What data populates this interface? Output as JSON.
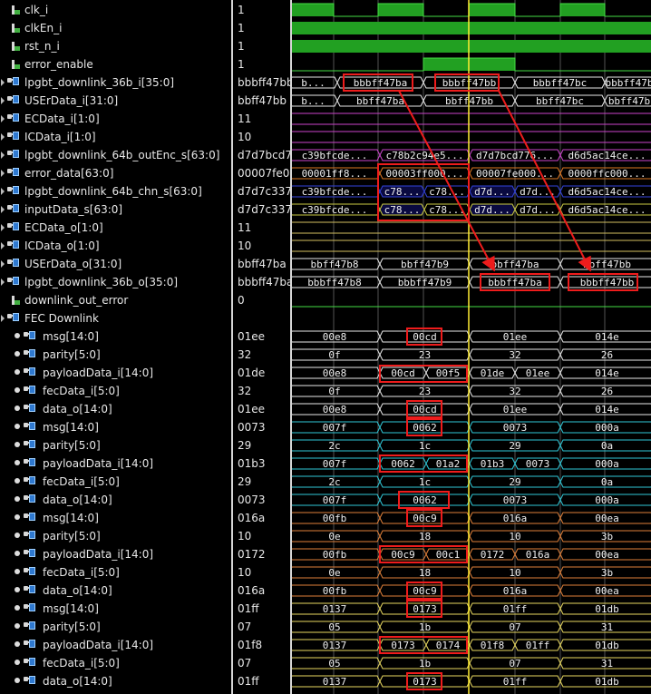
{
  "rows": [
    {
      "name": "clk_i",
      "value": "1",
      "kind": "bit",
      "wave": "clk"
    },
    {
      "name": "clkEn_i",
      "value": "1",
      "kind": "bit",
      "wave": "high"
    },
    {
      "name": "rst_n_i",
      "value": "1",
      "kind": "bit",
      "wave": "high"
    },
    {
      "name": "error_enable",
      "value": "1",
      "kind": "bit",
      "wave": "errEn"
    },
    {
      "name": "lpgbt_downlink_36b_i[35:0]",
      "value": "bbbff47bb",
      "kind": "bus",
      "expander": true,
      "color": "#e8e8e8",
      "segs": [
        "b...",
        "bbbff47ba",
        "bbbff47bb",
        "bbbff47bc",
        "bbbff47b"
      ]
    },
    {
      "name": "USErData_i[31:0]",
      "value": "bbff47bb",
      "kind": "bus",
      "expander": true,
      "color": "#e8e8e8",
      "segs": [
        "b...",
        "bbff47ba",
        "bbff47bb",
        "bbff47bc",
        "bbff47b"
      ]
    },
    {
      "name": "ECData_i[1:0]",
      "value": "11",
      "kind": "bus",
      "expander": true,
      "color": "#cc44cc",
      "segs": []
    },
    {
      "name": "ICData_i[1:0]",
      "value": "10",
      "kind": "bus",
      "expander": true,
      "color": "#cc44cc",
      "segs": []
    },
    {
      "name": "lpgbt_downlink_64b_outEnc_s[63:0]",
      "value": "d7d7bcd7",
      "kind": "bus",
      "expander": true,
      "color": "#cc44cc",
      "segs": [
        "c39bfcde...",
        "c78b2c94e5...",
        "d7d7bcd776...",
        "d6d5ac14ce..."
      ]
    },
    {
      "name": "error_data[63:0]",
      "value": "00007fe0",
      "kind": "bus",
      "expander": true,
      "color": "#dd7722",
      "segs": [
        "00001ff8...",
        "00003ff000...",
        "00007fe000...",
        "0000ffc000..."
      ]
    },
    {
      "name": "lpgbt_downlink_64b_chn_s[63:0]",
      "value": "d7d7c337",
      "kind": "bus",
      "expander": true,
      "color": "#3344dd",
      "segs": [
        "c39bfcde...",
        "c78...",
        "c78...",
        "d7d...",
        "d7d...",
        "d6d5ac14ce..."
      ]
    },
    {
      "name": "inputData_s[63:0]",
      "value": "d7d7c337",
      "kind": "bus",
      "expander": true,
      "color": "#cccc44",
      "segs": [
        "c39bfcde...",
        "c78...",
        "c78...",
        "d7d...",
        "d7d...",
        "d6d5ac14ce..."
      ]
    },
    {
      "name": "ECData_o[1:0]",
      "value": "11",
      "kind": "bus",
      "expander": true,
      "color": "#d4c060",
      "segs": []
    },
    {
      "name": "ICData_o[1:0]",
      "value": "10",
      "kind": "bus",
      "expander": true,
      "color": "#d4c060",
      "segs": []
    },
    {
      "name": "USErData_o[31:0]",
      "value": "bbff47ba",
      "kind": "bus",
      "expander": true,
      "color": "#e8e8e8",
      "segs": [
        "bbff47b8",
        "bbff47b9",
        "bbff47ba",
        "bbff47bb"
      ]
    },
    {
      "name": "lpgbt_downlink_36b_o[35:0]",
      "value": "bbbff47ba",
      "kind": "bus",
      "expander": true,
      "color": "#e8e8e8",
      "segs": [
        "bbbff47b8",
        "bbbff47b9",
        "bbbff47ba",
        "bbbff47bb"
      ]
    },
    {
      "name": "downlink_out_error",
      "value": "0",
      "kind": "bit",
      "wave": "low"
    },
    {
      "name": "FEC Downlink",
      "value": "",
      "kind": "group",
      "expander": true
    },
    {
      "name": "msg[14:0]",
      "value": "01ee",
      "kind": "sub",
      "color": "#e8e8e8",
      "segs": [
        "00e8",
        "00cd",
        "01ee",
        "014e"
      ]
    },
    {
      "name": "parity[5:0]",
      "value": "32",
      "kind": "sub",
      "color": "#e8e8e8",
      "segs": [
        "0f",
        "23",
        "32",
        "26"
      ]
    },
    {
      "name": "payloadData_i[14:0]",
      "value": "01de",
      "kind": "sub",
      "color": "#e8e8e8",
      "segs": [
        "00e8",
        "00cd",
        "00f5",
        "01de",
        "01ee",
        "014e"
      ]
    },
    {
      "name": "fecData_i[5:0]",
      "value": "32",
      "kind": "sub",
      "color": "#e8e8e8",
      "segs": [
        "0f",
        "23",
        "32",
        "26"
      ]
    },
    {
      "name": "data_o[14:0]",
      "value": "01ee",
      "kind": "sub",
      "color": "#e8e8e8",
      "segs": [
        "00e8",
        "00cd",
        "01ee",
        "014e"
      ]
    },
    {
      "name": "msg[14:0]",
      "value": "0073",
      "kind": "sub",
      "color": "#30c8d8",
      "segs": [
        "007f",
        "0062",
        "0073",
        "000a"
      ]
    },
    {
      "name": "parity[5:0]",
      "value": "29",
      "kind": "sub",
      "color": "#30c8d8",
      "segs": [
        "2c",
        "1c",
        "29",
        "0a"
      ]
    },
    {
      "name": "payloadData_i[14:0]",
      "value": "01b3",
      "kind": "sub",
      "color": "#30c8d8",
      "segs": [
        "007f",
        "0062",
        "01a2",
        "01b3",
        "0073",
        "000a"
      ]
    },
    {
      "name": "fecData_i[5:0]",
      "value": "29",
      "kind": "sub",
      "color": "#30c8d8",
      "segs": [
        "2c",
        "1c",
        "29",
        "0a"
      ]
    },
    {
      "name": "data_o[14:0]",
      "value": "0073",
      "kind": "sub",
      "color": "#30c8d8",
      "segs": [
        "007f",
        "0062",
        "0073",
        "000a"
      ]
    },
    {
      "name": "msg[14:0]",
      "value": "016a",
      "kind": "sub",
      "color": "#e0803a",
      "segs": [
        "00fb",
        "00c9",
        "016a",
        "00ea"
      ]
    },
    {
      "name": "parity[5:0]",
      "value": "10",
      "kind": "sub",
      "color": "#e0803a",
      "segs": [
        "0e",
        "18",
        "10",
        "3b"
      ]
    },
    {
      "name": "payloadData_i[14:0]",
      "value": "0172",
      "kind": "sub",
      "color": "#e0803a",
      "segs": [
        "00fb",
        "00c9",
        "00c1",
        "0172",
        "016a",
        "00ea"
      ]
    },
    {
      "name": "fecData_i[5:0]",
      "value": "10",
      "kind": "sub",
      "color": "#e0803a",
      "segs": [
        "0e",
        "18",
        "10",
        "3b"
      ]
    },
    {
      "name": "data_o[14:0]",
      "value": "016a",
      "kind": "sub",
      "color": "#e0803a",
      "segs": [
        "00fb",
        "00c9",
        "016a",
        "00ea"
      ]
    },
    {
      "name": "msg[14:0]",
      "value": "01ff",
      "kind": "sub",
      "color": "#e8d860",
      "segs": [
        "0137",
        "0173",
        "01ff",
        "01db"
      ]
    },
    {
      "name": "parity[5:0]",
      "value": "07",
      "kind": "sub",
      "color": "#e8d860",
      "segs": [
        "05",
        "1b",
        "07",
        "31"
      ]
    },
    {
      "name": "payloadData_i[14:0]",
      "value": "01f8",
      "kind": "sub",
      "color": "#e8d860",
      "segs": [
        "0137",
        "0173",
        "0174",
        "01f8",
        "01ff",
        "01db"
      ]
    },
    {
      "name": "fecData_i[5:0]",
      "value": "07",
      "kind": "sub",
      "color": "#e8d860",
      "segs": [
        "05",
        "1b",
        "07",
        "31"
      ]
    },
    {
      "name": "data_o[14:0]",
      "value": "01ff",
      "kind": "sub",
      "color": "#e8d860",
      "segs": [
        "0137",
        "0173",
        "01ff",
        "01db"
      ]
    }
  ],
  "colors": {
    "cursor": "#ffee33",
    "grid": "#8a8a8a",
    "annotation": "#ee1c1c",
    "bit_green": "#22a022"
  }
}
